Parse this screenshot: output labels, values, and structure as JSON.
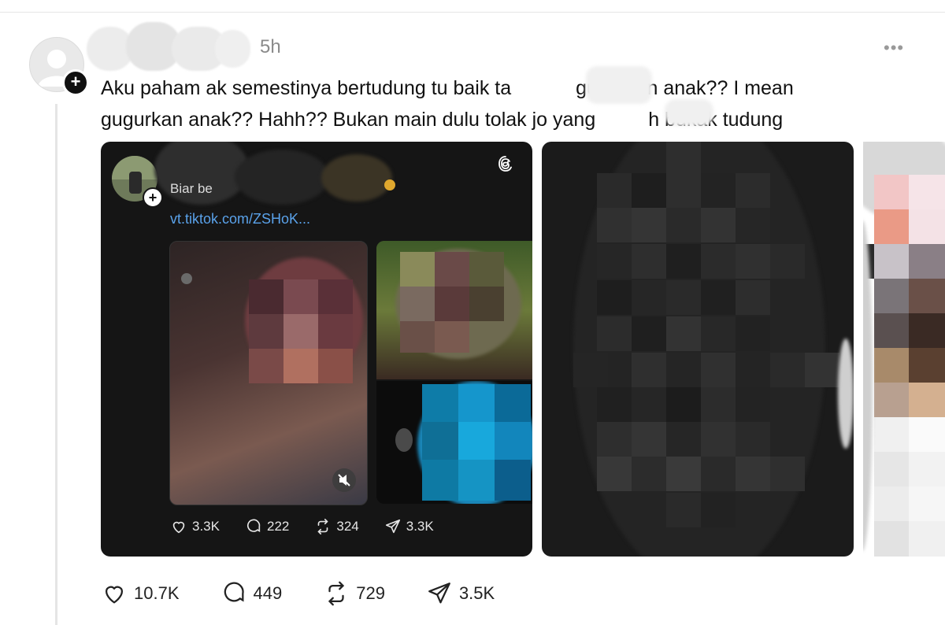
{
  "post": {
    "time": "5h",
    "more": "•••",
    "text_line1_a": "Aku paham ",
    "text_line1_b": "ak semestinya bertudung tu baik ta",
    "text_line1_c": "gugurkan anak?? I mean",
    "text_line2_a": "gugurkan anak?? Hahh?? Bukan main dulu tolak jo",
    "text_line2_b": " yang ",
    "text_line2_c": "h bukak tudung"
  },
  "quoted": {
    "caption": "Biar be",
    "link": "vt.tiktok.com/ZSHoK...",
    "likes": "3.3K",
    "replies": "222",
    "reposts": "324",
    "shares": "3.3K"
  },
  "actions": {
    "likes": "10.7K",
    "replies": "449",
    "reposts": "729",
    "shares": "3.5K"
  },
  "icons": [
    "plus-icon",
    "threads-logo-icon",
    "heart-icon",
    "comment-icon",
    "repost-icon",
    "share-icon",
    "mute-icon",
    "more-icon"
  ]
}
